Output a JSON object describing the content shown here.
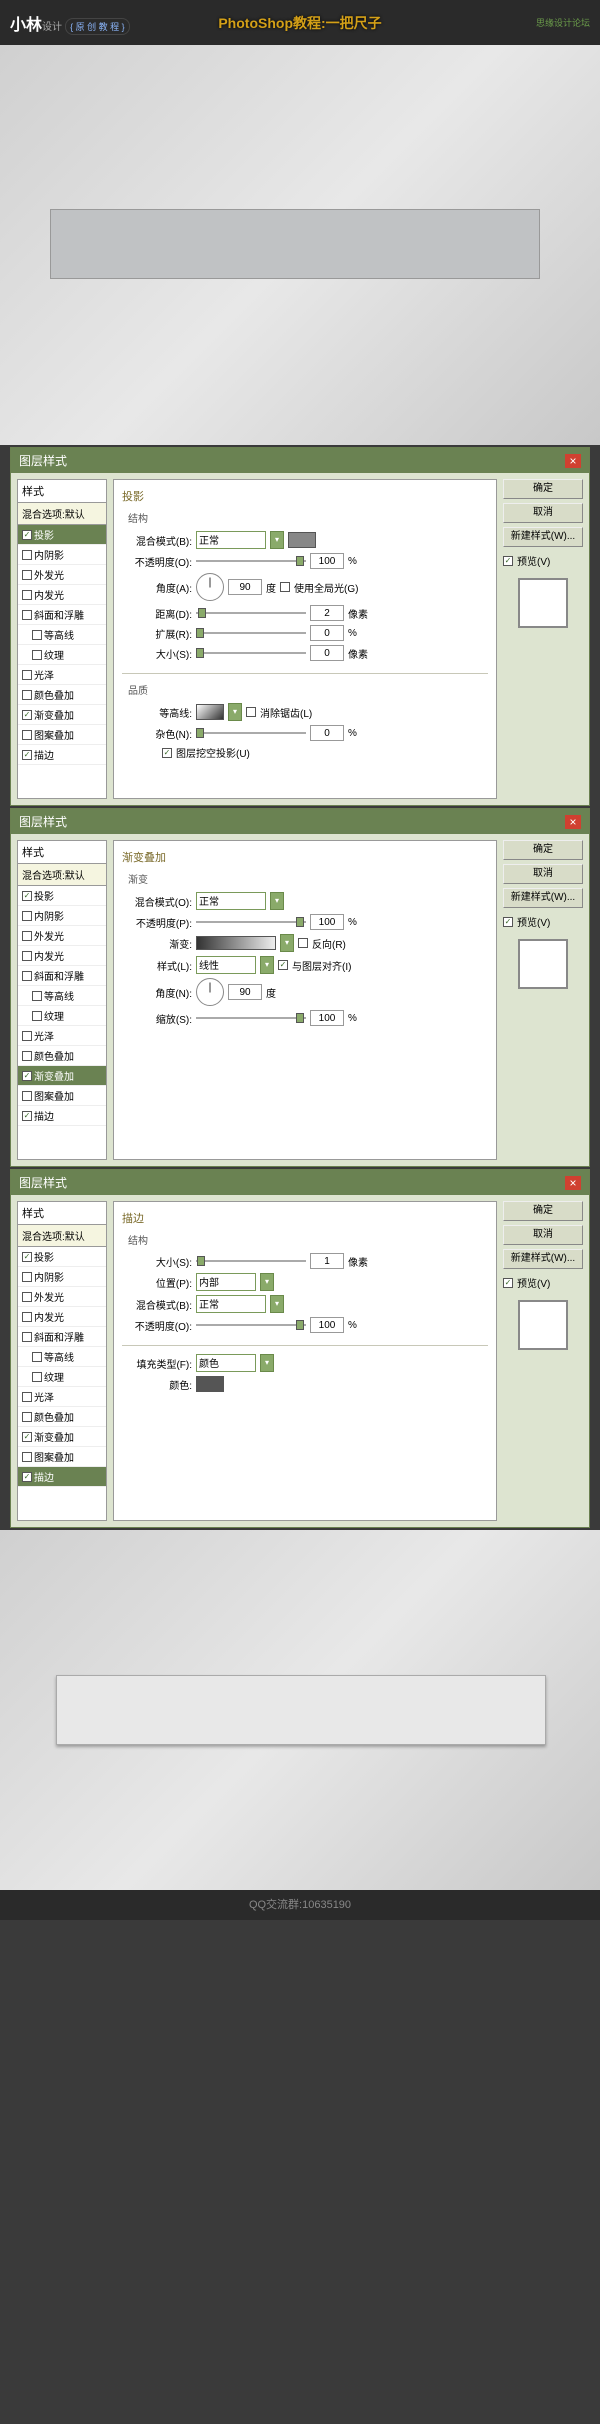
{
  "header": {
    "logo": "小林",
    "logo_suffix": "设计",
    "logo_sub": "{ 原 创 教 程 }",
    "title": "PhotoShop教程:一把尺子",
    "right": "思缘设计论坛"
  },
  "dialog_title": "图层样式",
  "styles": {
    "header": "样式",
    "sub": "混合选项:默认",
    "items": [
      {
        "label": "投影",
        "checked": true,
        "active_in": 1
      },
      {
        "label": "内阴影",
        "checked": false
      },
      {
        "label": "外发光",
        "checked": false
      },
      {
        "label": "内发光",
        "checked": false
      },
      {
        "label": "斜面和浮雕",
        "checked": false
      },
      {
        "label": "等高线",
        "checked": false,
        "indent": true
      },
      {
        "label": "纹理",
        "checked": false,
        "indent": true
      },
      {
        "label": "光泽",
        "checked": false
      },
      {
        "label": "颜色叠加",
        "checked": false
      },
      {
        "label": "渐变叠加",
        "checked": true,
        "active_in": 2
      },
      {
        "label": "图案叠加",
        "checked": false
      },
      {
        "label": "描边",
        "checked": true,
        "active_in": 3
      }
    ]
  },
  "buttons": {
    "ok": "确定",
    "cancel": "取消",
    "new_style": "新建样式(W)...",
    "preview": "预览(V)"
  },
  "d1": {
    "section": "投影",
    "struct": "结构",
    "blend_mode_label": "混合模式(B):",
    "blend_mode": "正常",
    "opacity_label": "不透明度(O):",
    "opacity": "100",
    "angle_label": "角度(A):",
    "angle": "90",
    "degree": "度",
    "global_light": "使用全局光(G)",
    "distance_label": "距离(D):",
    "distance": "2",
    "px": "像素",
    "spread_label": "扩展(R):",
    "spread": "0",
    "pct": "%",
    "size_label": "大小(S):",
    "size": "0",
    "quality": "品质",
    "contour_label": "等高线:",
    "anti_alias": "消除锯齿(L)",
    "noise_label": "杂色(N):",
    "noise": "0",
    "knockout": "图层挖空投影(U)"
  },
  "d2": {
    "section": "渐变叠加",
    "grad": "渐变",
    "blend_mode_label": "混合模式(O):",
    "blend_mode": "正常",
    "opacity_label": "不透明度(P):",
    "opacity": "100",
    "gradient_label": "渐变:",
    "reverse": "反向(R)",
    "style_label": "样式(L):",
    "style": "线性",
    "align": "与图层对齐(I)",
    "angle_label": "角度(N):",
    "angle": "90",
    "degree": "度",
    "scale_label": "缩放(S):",
    "scale": "100",
    "pct": "%"
  },
  "d3": {
    "section": "描边",
    "struct": "结构",
    "size_label": "大小(S):",
    "size": "1",
    "px": "像素",
    "position_label": "位置(P):",
    "position": "内部",
    "blend_mode_label": "混合模式(B):",
    "blend_mode": "正常",
    "opacity_label": "不透明度(O):",
    "opacity": "100",
    "pct": "%",
    "fill_type_label": "填充类型(F):",
    "fill_type": "颜色",
    "color_label": "颜色:"
  },
  "footer": "QQ交流群:10635190"
}
